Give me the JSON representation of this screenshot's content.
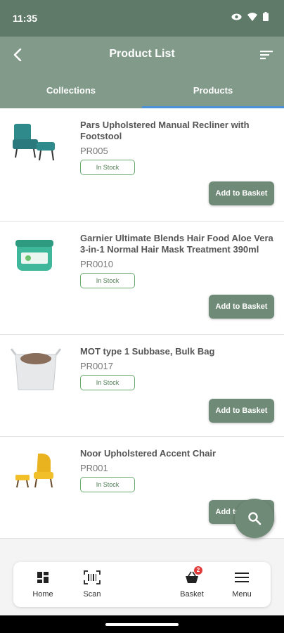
{
  "status_bar": {
    "time": "11:35"
  },
  "header": {
    "title": "Product List"
  },
  "tabs": [
    {
      "label": "Collections"
    },
    {
      "label": "Products"
    }
  ],
  "products": [
    {
      "name": "Pars Upholstered Manual Recliner with Footstool",
      "code": "PR005",
      "stock": "In Stock",
      "action": "Add to Basket"
    },
    {
      "name": "Garnier Ultimate Blends Hair Food Aloe Vera 3-in-1 Normal Hair Mask Treatment 390ml",
      "code": "PR0010",
      "stock": "In Stock",
      "action": "Add to Basket"
    },
    {
      "name": "MOT type 1 Subbase, Bulk Bag",
      "code": "PR0017",
      "stock": "In Stock",
      "action": "Add to Basket"
    },
    {
      "name": "Noor Upholstered Accent Chair",
      "code": "PR001",
      "stock": "In Stock",
      "action": "Add to Basket"
    }
  ],
  "bottom_nav": {
    "home": "Home",
    "scan": "Scan",
    "basket": "Basket",
    "basket_count": "2",
    "menu": "Menu"
  },
  "colors": {
    "header": "#819a89",
    "status": "#5f7a68",
    "accent_button": "#6f8a76",
    "tab_indicator": "#4a90d9",
    "stock_border": "#6aa96f"
  }
}
